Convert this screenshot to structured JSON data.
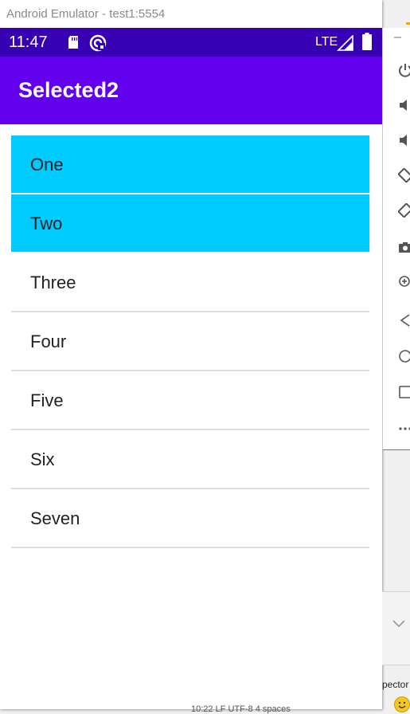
{
  "emulator": {
    "title": "Android Emulator - test1:5554"
  },
  "status_bar": {
    "time": "11:47",
    "network": "LTE",
    "icons": [
      "sd-card-icon",
      "sync-icon",
      "signal-icon",
      "battery-icon"
    ]
  },
  "app_bar": {
    "title": "Selected2",
    "color": "#6200ee",
    "status_color": "#3700b3"
  },
  "list": {
    "selected_color": "#00cbfe",
    "items": [
      {
        "label": "One",
        "selected": true
      },
      {
        "label": "Two",
        "selected": true
      },
      {
        "label": "Three",
        "selected": false
      },
      {
        "label": "Four",
        "selected": false
      },
      {
        "label": "Five",
        "selected": false
      },
      {
        "label": "Six",
        "selected": false
      },
      {
        "label": "Seven",
        "selected": false
      }
    ]
  },
  "emulator_toolbar": {
    "icons": [
      "power-icon",
      "volume-up-icon",
      "volume-down-icon",
      "rotate-left-icon",
      "rotate-right-icon",
      "camera-icon",
      "zoom-icon",
      "back-icon",
      "home-icon",
      "overview-icon",
      "more-icon"
    ]
  },
  "ide_background": {
    "panel_text": "pector",
    "bottom_text": "10:22  LF  UTF-8  4 spaces"
  }
}
